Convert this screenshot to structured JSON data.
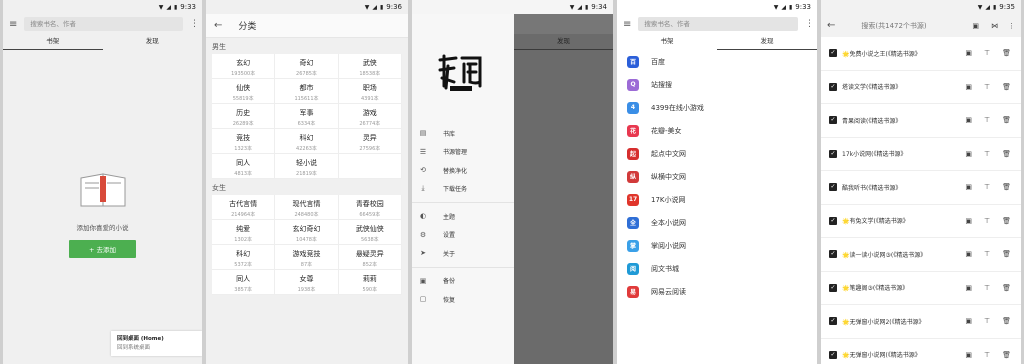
{
  "screen1": {
    "time": "9:33",
    "search_placeholder": "搜索书名、作者",
    "tabs": [
      "书架",
      "发现"
    ],
    "empty_text": "添加你喜爱的小说",
    "add_button": "+ 去添加",
    "toast_title": "回到桌面 (Home)",
    "toast_sub": "回到系统桌面"
  },
  "screen2": {
    "time": "9:36",
    "title": "分类",
    "male_label": "男生",
    "female_label": "女生",
    "male": [
      {
        "name": "玄幻",
        "count": "193500本"
      },
      {
        "name": "奇幻",
        "count": "26785本"
      },
      {
        "name": "武侠",
        "count": "18538本"
      },
      {
        "name": "仙侠",
        "count": "55819本"
      },
      {
        "name": "都市",
        "count": "115611本"
      },
      {
        "name": "职场",
        "count": "4391本"
      },
      {
        "name": "历史",
        "count": "26289本"
      },
      {
        "name": "军事",
        "count": "6334本"
      },
      {
        "name": "游戏",
        "count": "26774本"
      },
      {
        "name": "竞技",
        "count": "1323本"
      },
      {
        "name": "科幻",
        "count": "42263本"
      },
      {
        "name": "灵异",
        "count": "27596本"
      },
      {
        "name": "同人",
        "count": "4813本"
      },
      {
        "name": "轻小说",
        "count": "21819本"
      },
      {
        "name": "",
        "count": ""
      }
    ],
    "female": [
      {
        "name": "古代言情",
        "count": "214964本"
      },
      {
        "name": "现代言情",
        "count": "248480本"
      },
      {
        "name": "青春校园",
        "count": "66459本"
      },
      {
        "name": "纯爱",
        "count": "1302本"
      },
      {
        "name": "玄幻奇幻",
        "count": "10478本"
      },
      {
        "name": "武侠仙侠",
        "count": "5638本"
      },
      {
        "name": "科幻",
        "count": "5372本"
      },
      {
        "name": "游戏竞技",
        "count": "87本"
      },
      {
        "name": "悬疑灵异",
        "count": "852本"
      },
      {
        "name": "同人",
        "count": "3857本"
      },
      {
        "name": "女尊",
        "count": "1938本"
      },
      {
        "name": "莉莉",
        "count": "590本"
      }
    ]
  },
  "screen3": {
    "time": "9:34",
    "logo_text": "轻阅",
    "scrim_tab": "发现",
    "menu1": [
      {
        "icon": "book-icon",
        "glyph": "▤",
        "label": "书库"
      },
      {
        "icon": "list-icon",
        "glyph": "☰",
        "label": "书源管理"
      },
      {
        "icon": "replace-icon",
        "glyph": "⟲",
        "label": "替换净化"
      },
      {
        "icon": "download-icon",
        "glyph": "⤓",
        "label": "下载任务"
      }
    ],
    "menu2": [
      {
        "icon": "palette-icon",
        "glyph": "◐",
        "label": "主题"
      },
      {
        "icon": "settings-icon",
        "glyph": "⚙",
        "label": "设置"
      },
      {
        "icon": "send-icon",
        "glyph": "➤",
        "label": "关于"
      }
    ],
    "menu3": [
      {
        "icon": "backup-icon",
        "glyph": "▣",
        "label": "备份"
      },
      {
        "icon": "restore-icon",
        "glyph": "▢",
        "label": "恢复"
      }
    ]
  },
  "screen4": {
    "time": "9:33",
    "search_placeholder": "搜索书名、作者",
    "tabs": [
      "书架",
      "发现"
    ],
    "sources": [
      {
        "name": "百度",
        "color": "#2b5fd9",
        "glyph": "百"
      },
      {
        "name": "站搜搜",
        "color": "#9c6bd6",
        "glyph": "Q"
      },
      {
        "name": "4399在线小游戏",
        "color": "#3a8ee6",
        "glyph": "4"
      },
      {
        "name": "花瓣-美女",
        "color": "#e8384f",
        "glyph": "花"
      },
      {
        "name": "起点中文网",
        "color": "#d62e2e",
        "glyph": "起"
      },
      {
        "name": "纵横中文网",
        "color": "#d13a3a",
        "glyph": "纵"
      },
      {
        "name": "17K小说网",
        "color": "#e0352b",
        "glyph": "17"
      },
      {
        "name": "全本小说网",
        "color": "#2f6fd6",
        "glyph": "全"
      },
      {
        "name": "掌阅小说网",
        "color": "#3aa0e8",
        "glyph": "掌"
      },
      {
        "name": "阅文书城",
        "color": "#1f9ad6",
        "glyph": "阅"
      },
      {
        "name": "网易云阅读",
        "color": "#e03a3a",
        "glyph": "易"
      }
    ]
  },
  "screen5": {
    "time": "9:35",
    "search_placeholder": "搜索(共1472个书源)",
    "rows": [
      "🌟免费小说之王(《精选书源》",
      "塔读文学(《精选书源》",
      "青果阅读(《精选书源》",
      "17k小说网(《精选书源》",
      "酷我听书(《精选书源》",
      "🌟有兔文学(《精选书源》",
      "🌟读一读小说网③(《精选书源》",
      "🌟笔趣阁③(《精选书源》",
      "🌟无弹窗小说网2(《精选书源》",
      "🌟无弹窗小说网(《精选书源》"
    ]
  }
}
